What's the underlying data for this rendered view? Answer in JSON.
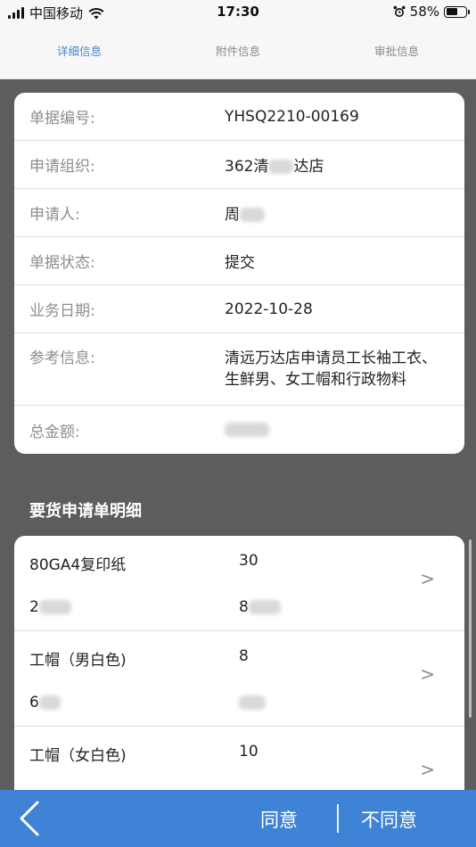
{
  "status_bar": {
    "carrier": "中国移动",
    "time": "17:30",
    "battery": "58%",
    "battery_level": 0.58
  },
  "tabs": [
    {
      "label": "详细信息",
      "active": true
    },
    {
      "label": "附件信息",
      "active": false
    },
    {
      "label": "审批信息",
      "active": false
    }
  ],
  "info": {
    "doc_no_label": "单据编号:",
    "doc_no_value": "YHSQ2210-00169",
    "org_label": "申请组织:",
    "org_value_prefix": "362清",
    "org_value_suffix": "达店",
    "applicant_label": "申请人:",
    "applicant_value": "周",
    "status_label": "单据状态:",
    "status_value": "提交",
    "date_label": "业务日期:",
    "date_value": "2022-10-28",
    "ref_label": "参考信息:",
    "ref_value": "清远万达店申请员工长袖工衣、生鲜男、女工帽和行政物料",
    "total_label": "总金额:"
  },
  "detail_section_title": "要货申请单明细",
  "detail_items": [
    {
      "name": "80GA4复印纸",
      "qty": "30",
      "sub1": "2",
      "sub2": "8"
    },
    {
      "name": "工帽（男白色)",
      "qty": "8",
      "sub1": "6",
      "sub2": ""
    },
    {
      "name": "工帽（女白色)",
      "qty": "10",
      "sub1": "",
      "sub2": ""
    }
  ],
  "bottom_bar": {
    "agree_label": "同意",
    "disagree_label": "不同意"
  },
  "icons": {
    "back": "chevron-left-icon",
    "arrow": "chevron-right-icon",
    "wifi": "wifi-icon",
    "alarm": "alarm-icon"
  },
  "colors": {
    "accent": "#3f83d6",
    "active_tab": "#4a86c9",
    "background": "#5d5d5d"
  }
}
